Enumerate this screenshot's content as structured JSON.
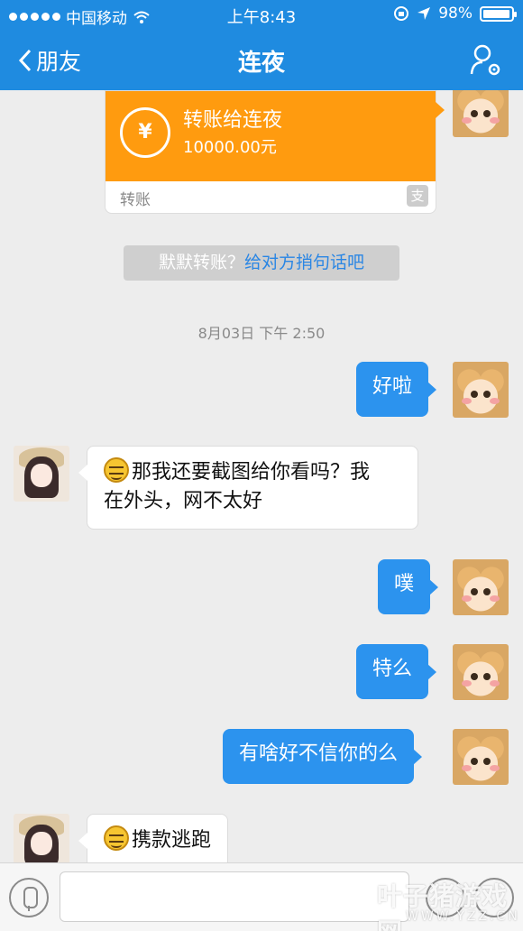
{
  "status_bar": {
    "carrier": "中国移动",
    "time": "上午8:43",
    "battery": "98%"
  },
  "nav": {
    "back_label": "朋友",
    "title": "连夜"
  },
  "transfer_card": {
    "title": "转账给连夜",
    "amount": "10000.00元",
    "footer": "转账",
    "alipay_glyph": "支",
    "coin_glyph": "¥"
  },
  "tip": {
    "prefix": "默默转账？",
    "link": "给对方捎句话吧"
  },
  "timestamp": "8月03日 下午 2:50",
  "messages": [
    {
      "side": "out",
      "text": "好啦"
    },
    {
      "side": "in",
      "text_line1": "那我还要截图给你看吗？我",
      "text_line2": "在外头，网不太好"
    },
    {
      "side": "out",
      "text": "噗"
    },
    {
      "side": "out",
      "text": "特么"
    },
    {
      "side": "out",
      "text": "有啥好不信你的么"
    },
    {
      "side": "in",
      "text": "携款逃跑"
    }
  ],
  "input": {
    "placeholder": ""
  },
  "watermark": {
    "line1": "叶子猪游戏网",
    "line2": "WWW.YZZ.CN"
  },
  "colors": {
    "nav_blue": "#1f8be0",
    "bubble_blue": "#2c93ee",
    "transfer_orange": "#ff9b0f"
  }
}
